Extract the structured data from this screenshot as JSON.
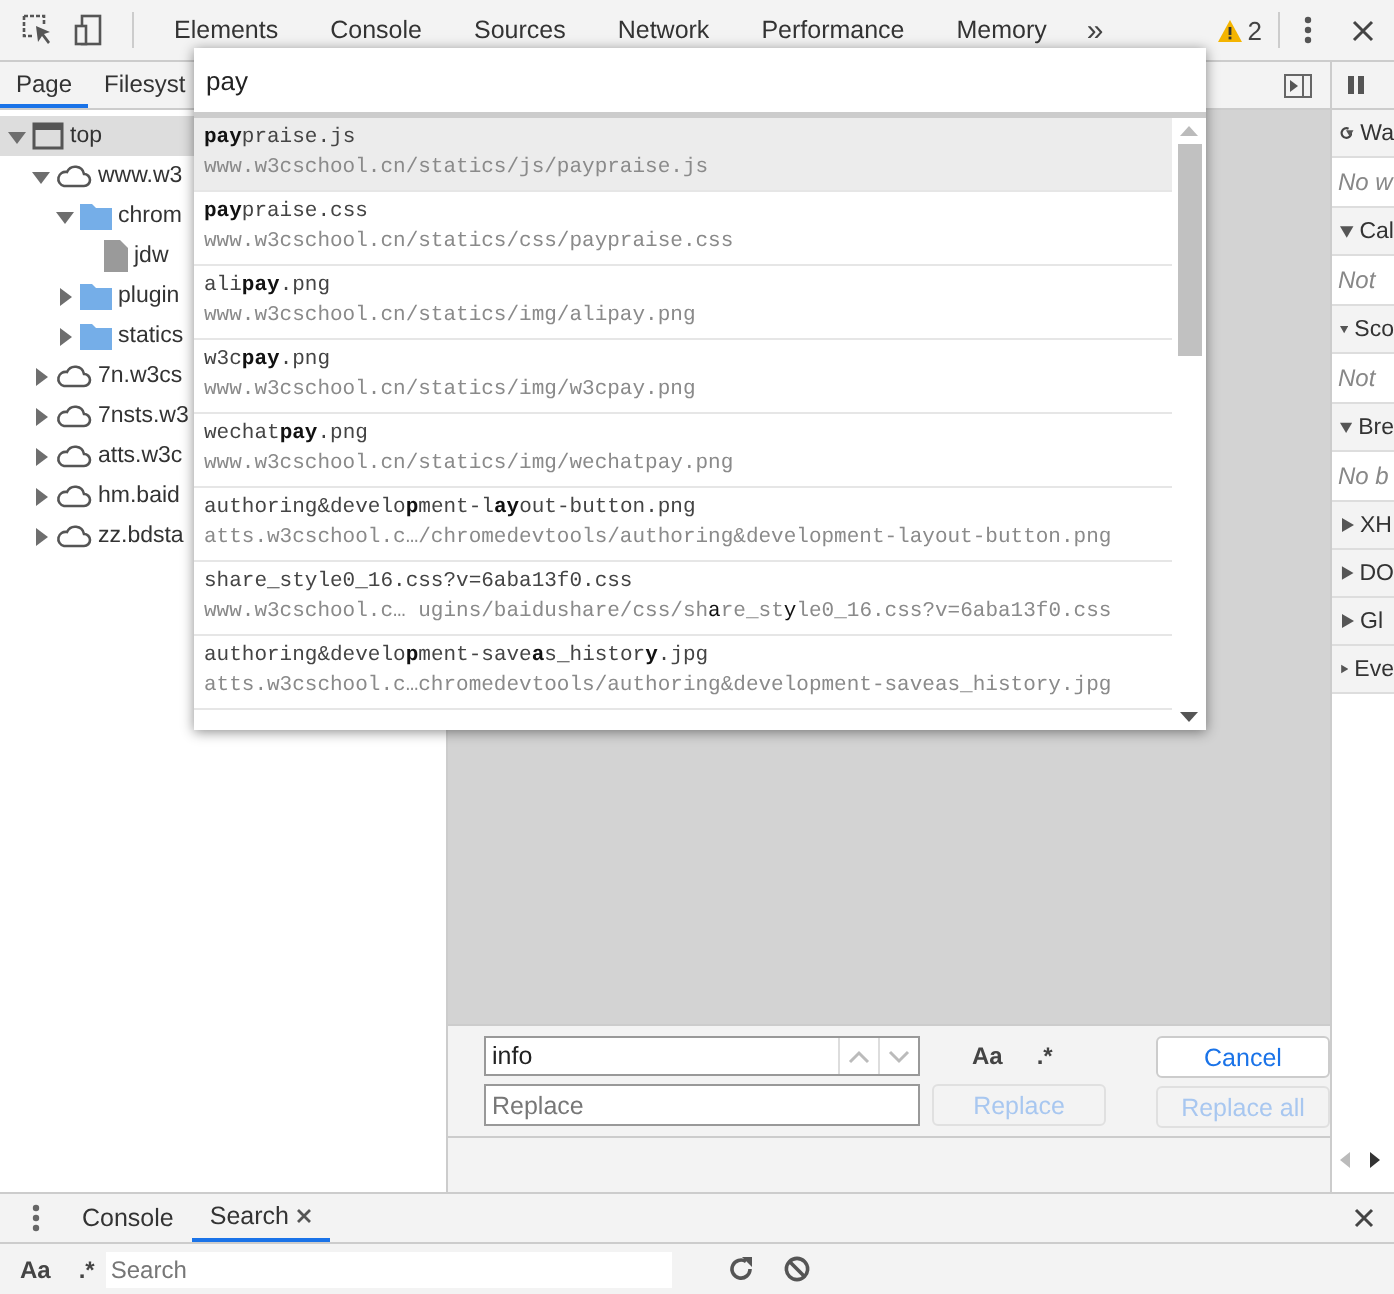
{
  "toolbar": {
    "tabs": [
      {
        "label": "Elements"
      },
      {
        "label": "Console"
      },
      {
        "label": "Sources"
      },
      {
        "label": "Network"
      },
      {
        "label": "Performance"
      },
      {
        "label": "Memory"
      }
    ],
    "more": "»",
    "warnings": "2"
  },
  "navigator": {
    "tabs": [
      {
        "label": "Page",
        "selected": true
      },
      {
        "label": "Filesyst",
        "selected": false
      }
    ],
    "tree": [
      {
        "label": "top",
        "kind": "frame",
        "expanded": true,
        "selected": true,
        "children": [
          {
            "label": "www.w3",
            "kind": "domain",
            "expanded": true,
            "selected": false,
            "children": [
              {
                "label": "chrom",
                "kind": "folder",
                "expanded": true,
                "selected": false,
                "children": [
                  {
                    "label": "jdw",
                    "kind": "file",
                    "selected": false
                  }
                ]
              },
              {
                "label": "plugin",
                "kind": "folder",
                "expanded": false,
                "selected": false
              },
              {
                "label": "statics",
                "kind": "folder",
                "expanded": false,
                "selected": false
              }
            ]
          },
          {
            "label": "7n.w3cs",
            "kind": "domain",
            "expanded": false,
            "selected": false
          },
          {
            "label": "7nsts.w3",
            "kind": "domain",
            "expanded": false,
            "selected": false
          },
          {
            "label": "atts.w3c",
            "kind": "domain",
            "expanded": false,
            "selected": false
          },
          {
            "label": "hm.baid",
            "kind": "domain",
            "expanded": false,
            "selected": false
          },
          {
            "label": "zz.bdsta",
            "kind": "domain",
            "expanded": false,
            "selected": false
          }
        ]
      }
    ]
  },
  "quick_open": {
    "query": "pay",
    "items": [
      {
        "name": "**pay**praise.js",
        "url": "www.w3cschool.cn/statics/js/paypraise.js",
        "selected": true
      },
      {
        "name": "**pay**praise.css",
        "url": "www.w3cschool.cn/statics/css/paypraise.css",
        "selected": false
      },
      {
        "name": "ali**pay**.png",
        "url": "www.w3cschool.cn/statics/img/alipay.png",
        "selected": false
      },
      {
        "name": "w3c**pay**.png",
        "url": "www.w3cschool.cn/statics/img/w3cpay.png",
        "selected": false
      },
      {
        "name": "wechat**pay**.png",
        "url": "www.w3cschool.cn/statics/img/wechatpay.png",
        "selected": false
      },
      {
        "name": "authoring&develo**p**ment-l**ay**out-button.png",
        "url": "atts.w3cschool.c…/chromedevtools/authoring&development-layout-button.png",
        "selected": false
      },
      {
        "name": "share_style0_16.css?v=6aba13f0.css",
        "url": "www.w3cschool.c… ugins/baidushare/css/sh**a**re_st**y**le0_16.css?v=6aba13f0.css",
        "selected": false
      },
      {
        "name": "authoring&develo**p**ment-save**a**s_histor**y**.jpg",
        "url": "atts.w3cschool.c…chromedevtools/authoring&development-saveas_history.jpg",
        "selected": false
      }
    ]
  },
  "debugger": {
    "sections": [
      {
        "title": "Wa",
        "kind": "watch",
        "expanded": true,
        "message": "No w"
      },
      {
        "title": "Cal",
        "kind": "pane",
        "expanded": true,
        "message": "Not"
      },
      {
        "title": "Sco",
        "kind": "pane",
        "expanded": true,
        "message": "Not"
      },
      {
        "title": "Bre",
        "kind": "pane",
        "expanded": true,
        "message": "No b"
      },
      {
        "title": "XH",
        "kind": "pane",
        "expanded": false
      },
      {
        "title": "DO",
        "kind": "pane",
        "expanded": false
      },
      {
        "title": "Gl",
        "kind": "pane",
        "expanded": false
      },
      {
        "title": "Eve",
        "kind": "pane",
        "expanded": false
      }
    ]
  },
  "replace_bar": {
    "find_value": "info",
    "replace_placeholder": "Replace",
    "case_label": "Aa",
    "regex_label": ".*",
    "buttons": [
      {
        "label": "Cancel",
        "disabled": false
      },
      {
        "label": "Replace",
        "disabled": true
      },
      {
        "label": "Replace all",
        "disabled": true
      }
    ]
  },
  "drawer": {
    "tabs": [
      {
        "label": "Console",
        "selected": false,
        "closable": false
      },
      {
        "label": "Search",
        "selected": true,
        "closable": true
      }
    ],
    "case_label": "Aa",
    "regex_label": ".*",
    "search_placeholder": "Search"
  }
}
